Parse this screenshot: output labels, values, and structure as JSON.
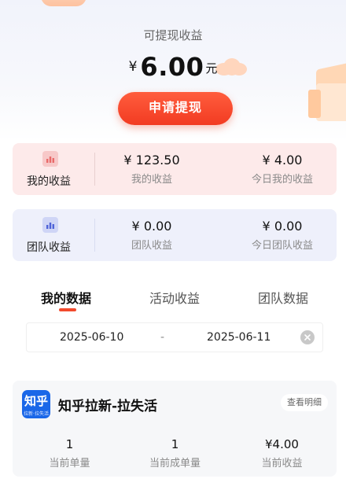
{
  "withdraw": {
    "label": "可提现收益",
    "currency": "¥",
    "amount": "6.00",
    "unit": "元",
    "apply_button": "申请提现"
  },
  "my_earnings": {
    "label": "我的收益",
    "icon": "bar-chart-icon",
    "stats": [
      {
        "value": "¥ 123.50",
        "label": "我的收益"
      },
      {
        "value": "¥ 4.00",
        "label": "今日我的收益"
      }
    ]
  },
  "team_earnings": {
    "label": "团队收益",
    "icon": "bar-chart-icon",
    "stats": [
      {
        "value": "¥ 0.00",
        "label": "团队收益"
      },
      {
        "value": "¥ 0.00",
        "label": "今日团队收益"
      }
    ]
  },
  "tabs": [
    {
      "label": "我的数据",
      "active": true
    },
    {
      "label": "活动收益",
      "active": false
    },
    {
      "label": "团队数据",
      "active": false
    }
  ],
  "date_range": {
    "start": "2025-06-10",
    "separator": "-",
    "end": "2025-06-11"
  },
  "task": {
    "logo_text": "知乎",
    "logo_subtext": "拉新·拉失活",
    "title": "知乎拉新-拉失活",
    "detail_button": "查看明细",
    "stats": [
      {
        "value": "1",
        "label": "当前单量"
      },
      {
        "value": "1",
        "label": "当前成单量"
      },
      {
        "value": "¥4.00",
        "label": "当前收益"
      }
    ]
  },
  "colors": {
    "accent": "#f23b22",
    "my_card_bg": "#fdeaea",
    "team_card_bg": "#eef0fb"
  }
}
